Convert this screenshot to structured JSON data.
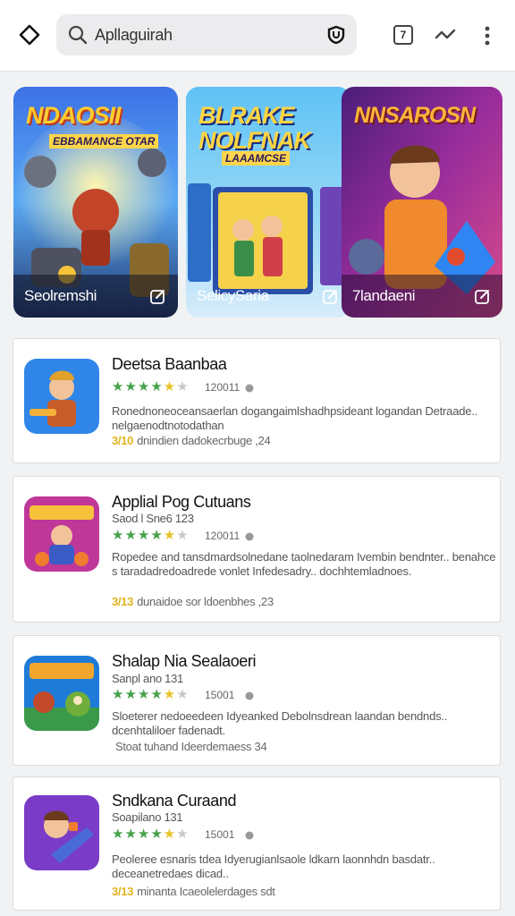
{
  "header": {
    "search_query": "Apllaguirah",
    "tab_count": "7"
  },
  "featured": [
    {
      "title": "NDAOSII",
      "subtitle": "EBBAMANCE OTAR",
      "label": "Seolremshi",
      "colors": [
        "#2a59d8",
        "#f58a2a"
      ]
    },
    {
      "title": "BLRAKE NOLFNAK",
      "subtitle": "LAAAMCSE",
      "label": "SelicySaria",
      "colors": [
        "#3fb4f2",
        "#ffd54a"
      ]
    },
    {
      "title": "NNSAROSN",
      "subtitle": "",
      "label": "7landaeni",
      "colors": [
        "#7b2fa0",
        "#f0548b"
      ]
    }
  ],
  "apps": [
    {
      "title": "Deetsa Baanbaa",
      "subtitle": "",
      "rating": 4.5,
      "count": "120011",
      "description": "Ronednoneoceansaerlan dogangaimlshadhpsideant logandan Detraade.. nelgaenodtnotodathan",
      "meta_badge": "3/10",
      "meta": "dnindien dadokecrbuge ,24",
      "icon_colors": [
        "#2f86e8",
        "#f5b23a"
      ]
    },
    {
      "title": "Applial Pog Cutuans",
      "subtitle": "Saod l Sne6 123",
      "rating": 4.5,
      "count": "120011",
      "description": "Ropedee and tansdmardsolnedane taolnedaram Ivembin bendnter.. benahce s taradadredoadrede vonlet Infedesadry.. dochhtemladnoes.",
      "meta_badge": "3/13",
      "meta": "dunaidoe sor ldoenbhes ,23",
      "icon_colors": [
        "#c0379a",
        "#f7c23c"
      ]
    },
    {
      "title": "Shalap Nia Sealaoeri",
      "subtitle": "Sanpl ano 131",
      "rating": 4.5,
      "count": "15001",
      "description": "Sloeterer nedoeedeen Idyeanked Debolnsdrean laandan bendnds.. dcenhtaliloer fadenadt.",
      "meta_badge": "",
      "meta": "Stoat tuhand Ideerdemaess 34",
      "icon_colors": [
        "#1f7bd8",
        "#f2a52c"
      ]
    },
    {
      "title": "Sndkana Curaand",
      "subtitle": "Soapilano 131",
      "rating": 4.5,
      "count": "15001",
      "description": "Peoleree esnaris tdea Idyerugianlsaole ldkarn laonnhdn basdatr.. deceanetredaes dicad..",
      "meta_badge": "3/13",
      "meta": "minanta Icaeolelerdages sdt",
      "icon_colors": [
        "#7a3cc7",
        "#f07c2e"
      ]
    }
  ]
}
